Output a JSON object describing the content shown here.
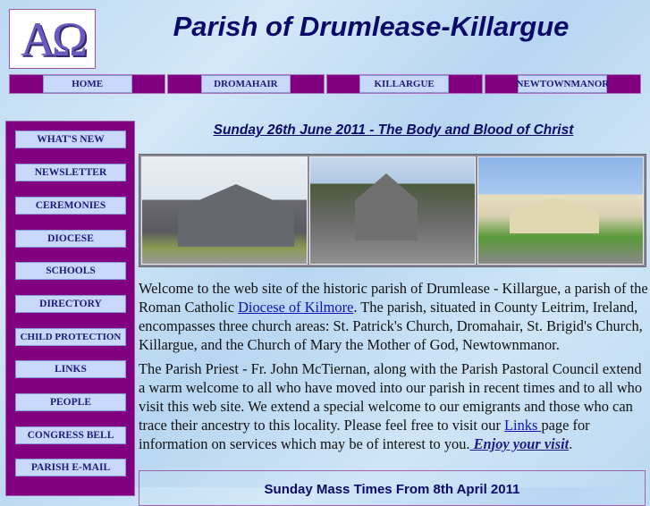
{
  "logo": {
    "glyphs": "AΩ"
  },
  "header": {
    "title": "Parish of Drumlease-Killargue"
  },
  "nav": [
    "HOME",
    "DROMAHAIR",
    "KILLARGUE",
    "NEWTOWNMANOR"
  ],
  "sidebar": [
    "WHAT'S NEW",
    "NEWSLETTER",
    "CEREMONIES",
    "DIOCESE",
    "SCHOOLS",
    "DIRECTORY",
    "CHILD PROTECTION",
    "LINKS",
    "PEOPLE",
    "CONGRESS BELL",
    "PARISH E-MAIL"
  ],
  "main": {
    "heading": "Sunday 26th June 2011 - The Body and Blood of Christ",
    "p1_a": "Welcome to the web site of the historic parish of Drumlease - Killargue, a parish of the Roman Catholic ",
    "p1_link": "Diocese of Kilmore",
    "p1_b": ". The parish, situated in County Leitrim, Ireland, encompasses three church areas: St. Patrick's Church, Dromahair, St. Brigid's Church, Killargue, and the Church of Mary the Mother of God, Newtownmanor.",
    "p2_a": "The Parish Priest - Fr. John McTiernan, along with the Parish Pastoral Council extend a warm welcome to all who have moved into our parish in recent times and to all who visit this web site. We extend a special welcome to our emigrants and those who can trace their ancestry to this locality. Please feel free to visit our ",
    "p2_link": "Links ",
    "p2_b": "page for information on services which may be of interest to you.",
    "p2_enjoy": " Enjoy your visit",
    "p2_end": ".",
    "box_title": "Sunday Mass Times From 8th April 2011"
  },
  "colors": {
    "purple": "#800080",
    "button": "#c8d8fb",
    "title": "#0a0a6a"
  }
}
